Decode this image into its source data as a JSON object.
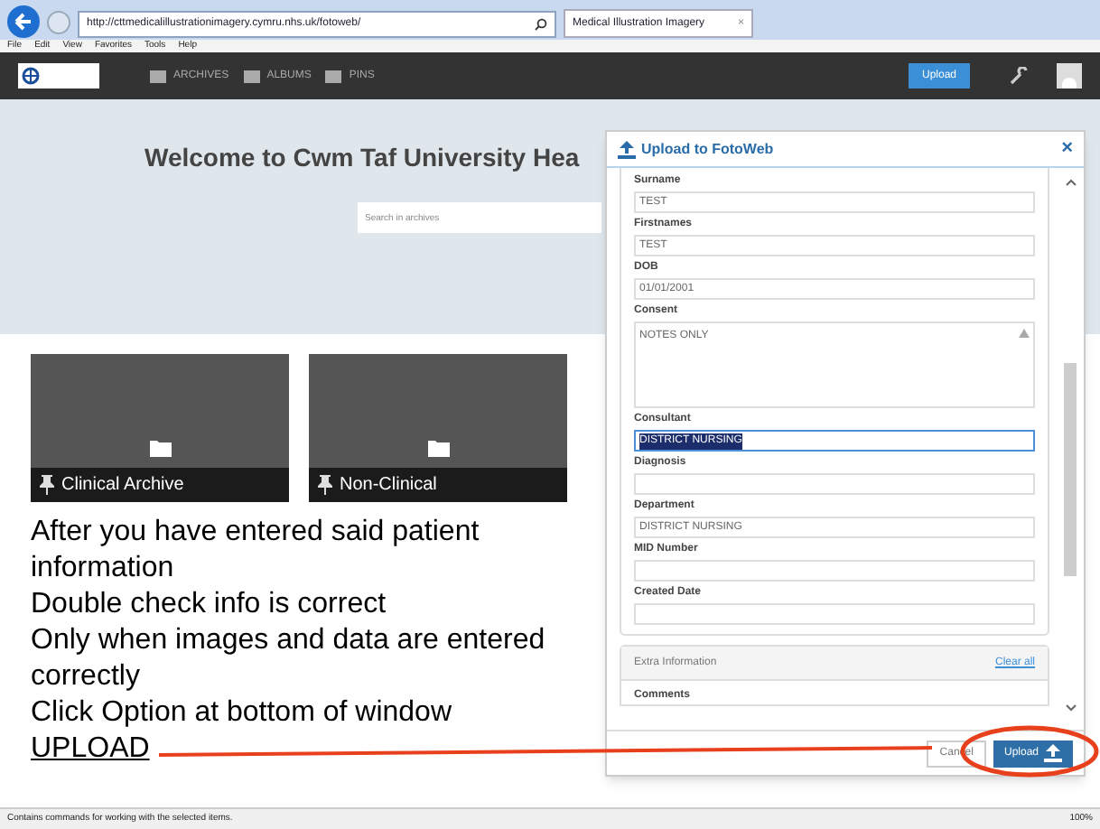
{
  "browser": {
    "url": "http://cttmedicalillustrationimagery.cymru.nhs.uk/fotoweb/",
    "tab": "Medical Illustration Imagery",
    "tab_close": "×",
    "menu": [
      "File",
      "Edit",
      "View",
      "Favorites",
      "Tools",
      "Help"
    ]
  },
  "nav": {
    "items": [
      "ARCHIVES",
      "ALBUMS",
      "PINS"
    ],
    "upload": "Upload"
  },
  "hero": {
    "title": "Welcome to Cwm Taf University Hea",
    "search": {
      "placeholder": "Search in archives"
    }
  },
  "cards": [
    {
      "label": "Clinical Archive"
    },
    {
      "label": "Non-Clinical"
    }
  ],
  "notes": [
    {
      "text": "After you have entered said patient information",
      "underline": false
    },
    {
      "text": "Double check info is correct",
      "underline": false
    },
    {
      "text": "Only when images and data are entered correctly",
      "underline": false
    },
    {
      "text": "Click Option at bottom of window",
      "underline": false
    },
    {
      "text": "UPLOAD",
      "underline": true
    }
  ],
  "modal": {
    "title": "Upload to FotoWeb",
    "close": "×",
    "fields": [
      {
        "label": "Surname",
        "value": "TEST",
        "kind": "text",
        "highlighted": false
      },
      {
        "label": "Firstnames",
        "value": "TEST",
        "kind": "text",
        "highlighted": false
      },
      {
        "label": "DOB",
        "value": "01/01/2001",
        "kind": "text",
        "highlighted": false
      },
      {
        "label": "Consent",
        "value": "NOTES ONLY",
        "kind": "textarea",
        "highlighted": false
      },
      {
        "label": "Consultant",
        "value": "DISTRICT NURSING",
        "kind": "text",
        "highlighted": true
      },
      {
        "label": "Diagnosis",
        "kind": "text",
        "highlighted": false
      },
      {
        "label": "Department",
        "value": "DISTRICT NURSING",
        "kind": "text",
        "highlighted": false
      },
      {
        "label": "MID Number",
        "kind": "text",
        "highlighted": false
      },
      {
        "label": "Created Date",
        "kind": "text",
        "highlighted": false
      }
    ],
    "extra": {
      "title": "Extra Information",
      "clear": "Clear all",
      "comments": "Comments"
    },
    "cancel": "Cancel",
    "upload": "Upload"
  },
  "status_bar": {
    "text": "Contains commands for working with the selected items.",
    "zoom": "100%"
  }
}
